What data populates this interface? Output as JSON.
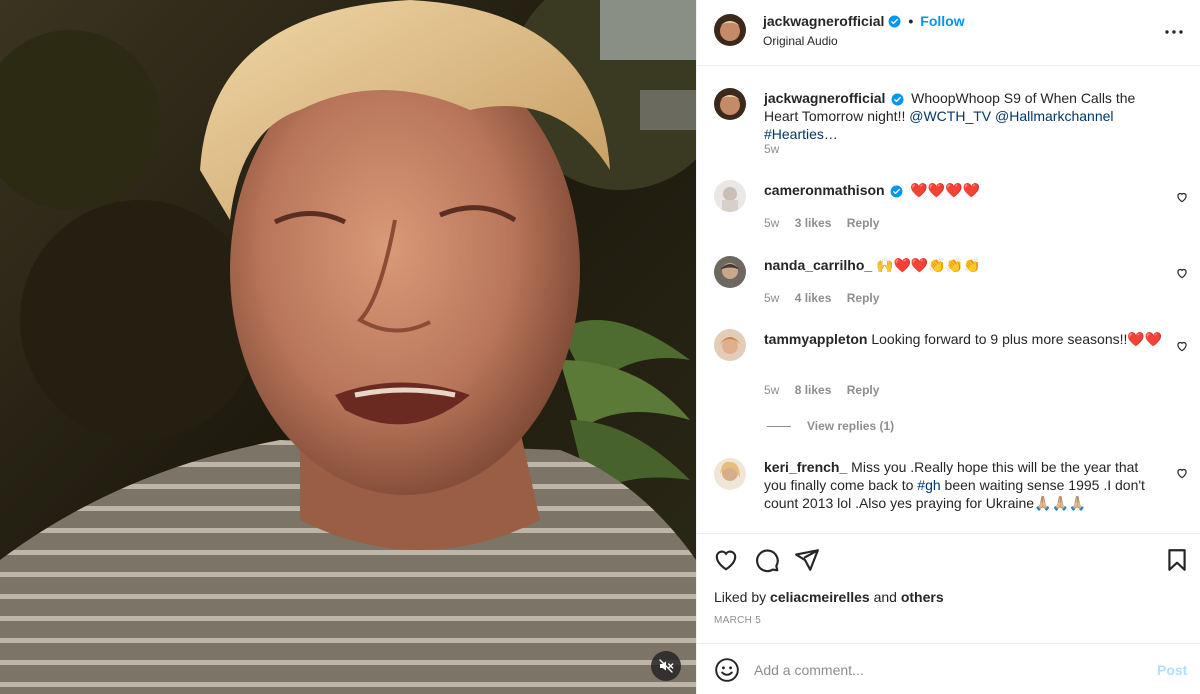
{
  "post": {
    "username": "jackwagnerofficial",
    "verified": true,
    "follow_label": "Follow",
    "separator": "•",
    "audio": "Original Audio",
    "caption_text": "WhoopWhoop S9 of When Calls the Heart Tomorrow night!! ",
    "caption_mentions": [
      "@WCTH_TV",
      "@Hallmarkchannel"
    ],
    "caption_hashtag": "#Hearties…",
    "caption_time": "5w",
    "liked_by_prefix": "Liked by ",
    "liked_by_user": "celiacmeirelles",
    "liked_by_and": " and ",
    "liked_by_others": "others",
    "date": "MARCH 5",
    "comment_placeholder": "Add a comment...",
    "post_label": "Post"
  },
  "comments": [
    {
      "username": "cameronmathison",
      "verified": true,
      "text": "❤️❤️❤️❤️",
      "time": "5w",
      "likes": "3 likes",
      "reply": "Reply"
    },
    {
      "username": "nanda_carrilho_",
      "verified": false,
      "text": "🙌❤️❤️👏👏👏",
      "time": "5w",
      "likes": "4 likes",
      "reply": "Reply"
    },
    {
      "username": "tammyappleton",
      "verified": false,
      "text": "Looking forward to 9 plus more seasons!!❤️❤️",
      "time": "5w",
      "likes": "8 likes",
      "reply": "Reply",
      "view_replies": "View replies (1)"
    },
    {
      "username": "keri_french_",
      "verified": false,
      "text_a": "Miss you .Really hope this will be the year that you finally come back to ",
      "hashtag": "#gh",
      "text_b": " been waiting sense 1995 .I don't count 2013 lol .Also yes praying for Ukraine🙏🏼🙏🏼🙏🏼"
    }
  ],
  "icons": [
    "verified-badge-icon",
    "more-options-icon",
    "heart-icon",
    "comment-icon",
    "share-icon",
    "save-icon",
    "emoji-icon",
    "muted-audio-icon"
  ],
  "colors": {
    "link_blue": "#0095f6",
    "mention_blue": "#00376b",
    "muted_text": "#8e8e8e",
    "post_disabled": "#b2dffc",
    "verified": "#0095f6"
  }
}
